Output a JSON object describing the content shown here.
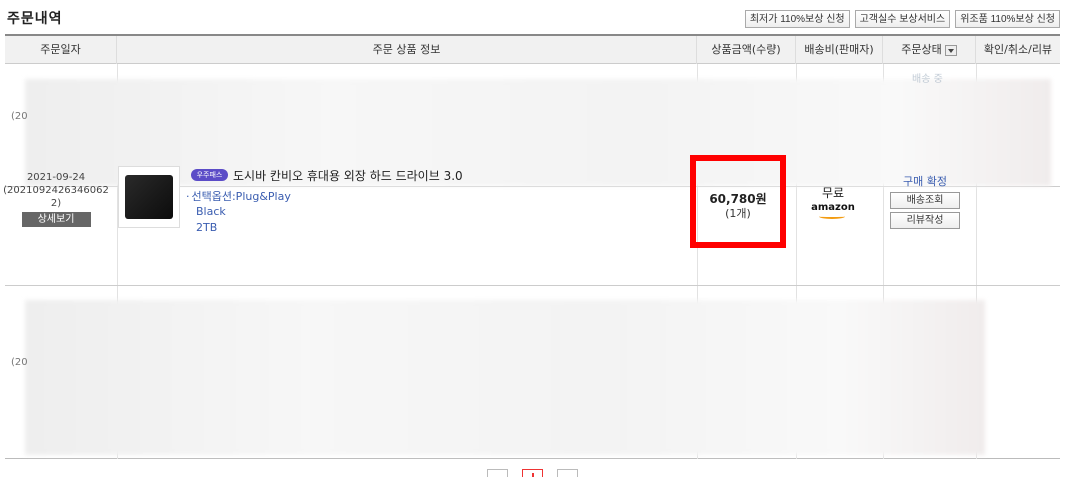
{
  "page": {
    "title": "주문내역",
    "buttons": [
      "최저가 110%보상 신청",
      "고객실수 보상서비스",
      "위조품 110%보상 신청"
    ]
  },
  "table": {
    "headers": {
      "date": "주문일자",
      "product": "주문 상품 정보",
      "price": "상품금액(수량)",
      "shipping": "배송비(판매자)",
      "status": "주문상태",
      "action": "확인/취소/리뷰"
    }
  },
  "blurred_rows": [
    {
      "date_partial": "(20",
      "status_partial": "배송 중"
    },
    {
      "date_partial": "(20"
    }
  ],
  "order": {
    "date": "2021-09-24",
    "order_no_line1": "(2021092426346062",
    "order_no_line2": "2)",
    "detail_label": "상세보기",
    "badge": "우주패스",
    "product_name": "도시바 칸비오 휴대용 외장 하드 드라이브 3.0",
    "option_label": "선택옵션:Plug&Play",
    "option_color": "Black",
    "option_size": "2TB",
    "price": "60,780원",
    "quantity": "(1개)",
    "shipping_fee": "무료",
    "seller": "amazon",
    "status": "구매 확정",
    "btn_tracking": "배송조회",
    "btn_review": "리뷰작성"
  },
  "colors": {
    "highlight": "#ff0000",
    "link": "#3a5db0",
    "badge": "#5b4cc7"
  }
}
